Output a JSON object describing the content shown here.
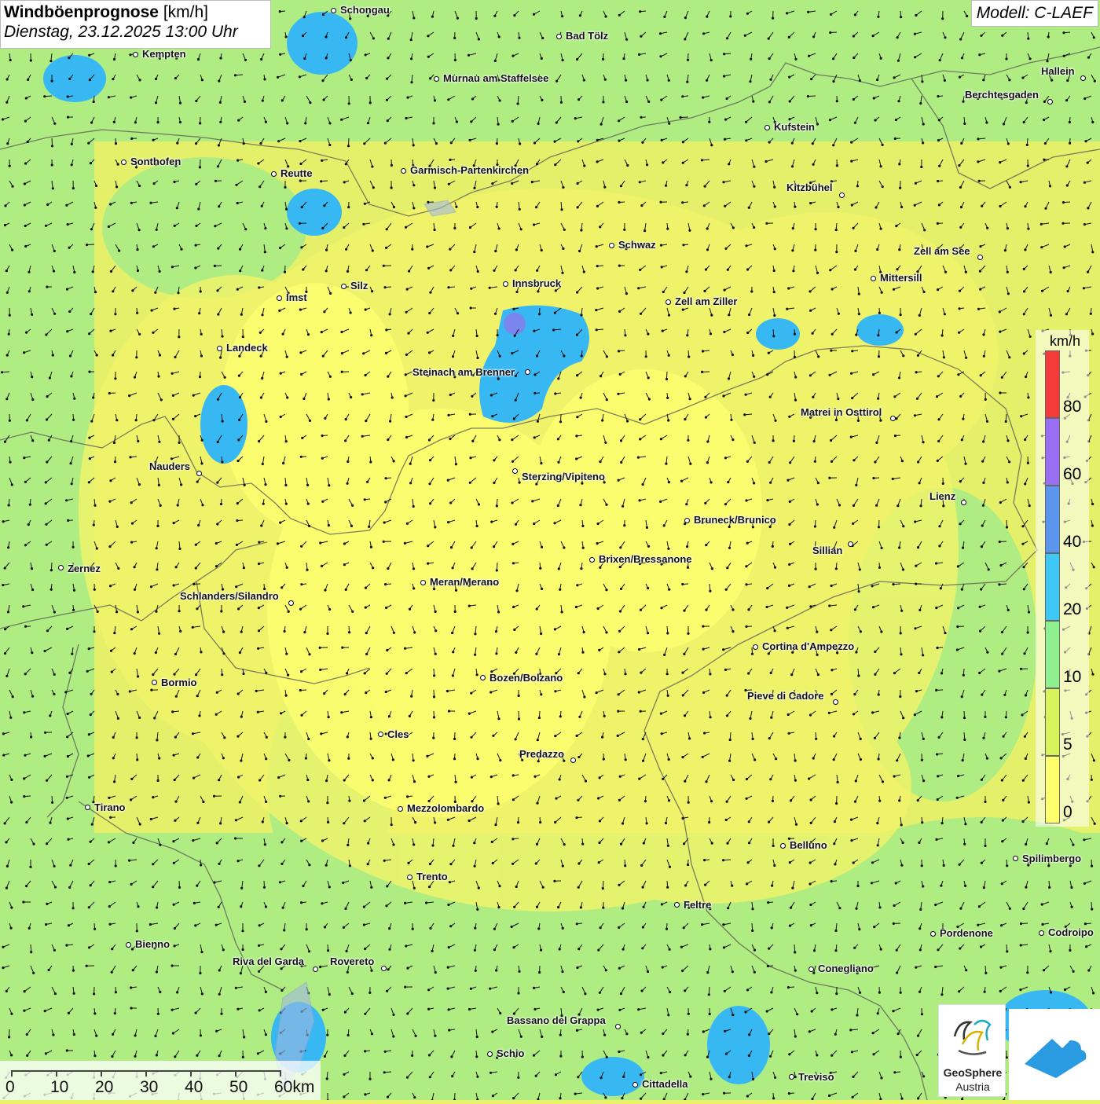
{
  "header": {
    "title": "Windböenprognose",
    "unit": "[km/h]",
    "datetime": "Dienstag, 23.12.2025 13:00 Uhr",
    "model": "Modell: C-LAEF"
  },
  "legend": {
    "unit": "km/h",
    "colors": [
      "#ffff6e",
      "#d7f55a",
      "#8ef08e",
      "#3ec8f5",
      "#5a96ee",
      "#9a6ef2",
      "#f53a3a"
    ],
    "values": [
      "0",
      "5",
      "10",
      "20",
      "40",
      "60",
      "80"
    ]
  },
  "cities": [
    {
      "name": "Schongau",
      "label": "Schongau"
    },
    {
      "name": "Bad Tölz",
      "label": "Bad Tölz"
    },
    {
      "name": "Kempten",
      "label": "Kempten"
    },
    {
      "name": "Murnau am Staffelsee",
      "label": "Murnau am Staffelsee"
    },
    {
      "name": "Hallein",
      "label": "Hallein"
    },
    {
      "name": "Berchtesgaden",
      "label": "Berchtesgaden"
    },
    {
      "name": "Kufstein",
      "label": "Kufstein"
    },
    {
      "name": "Sonthofen",
      "label": "Sonthofen"
    },
    {
      "name": "Reutte",
      "label": "Reutte"
    },
    {
      "name": "Garmisch-Partenkirchen",
      "label": "Garmisch-Partenkirchen"
    },
    {
      "name": "Kitzbühel",
      "label": "Kitzbühel"
    },
    {
      "name": "Schwaz",
      "label": "Schwaz"
    },
    {
      "name": "Zell am See",
      "label": "Zell am See"
    },
    {
      "name": "Innsbruck",
      "label": "Innsbruck"
    },
    {
      "name": "Mittersill",
      "label": "Mittersill"
    },
    {
      "name": "Silz",
      "label": "Silz"
    },
    {
      "name": "Imst",
      "label": "Imst"
    },
    {
      "name": "Zell am Ziller",
      "label": "Zell am Ziller"
    },
    {
      "name": "Landeck",
      "label": "Landeck"
    },
    {
      "name": "Steinach am Brenner",
      "label": "Steinach am Brenner"
    },
    {
      "name": "Matrei in Osttirol",
      "label": "Matrei in Osttirol"
    },
    {
      "name": "Nauders",
      "label": "Nauders"
    },
    {
      "name": "Sterzing/Vipiteno",
      "label": "Sterzing/Vipiteno"
    },
    {
      "name": "Lienz",
      "label": "Lienz"
    },
    {
      "name": "Bruneck/Brunico",
      "label": "Bruneck/Brunico"
    },
    {
      "name": "Sillian",
      "label": "Sillian"
    },
    {
      "name": "Brixen/Bressanone",
      "label": "Brixen/Bressanone"
    },
    {
      "name": "Zernez",
      "label": "Zernez"
    },
    {
      "name": "Meran/Merano",
      "label": "Meran/Merano"
    },
    {
      "name": "Schlanders/Silandro",
      "label": "Schlanders/Silandro"
    },
    {
      "name": "Cortina d'Ampezzo",
      "label": "Cortina d'Ampezzo"
    },
    {
      "name": "Bozen/Bolzano",
      "label": "Bozen/Bolzano"
    },
    {
      "name": "Bormio",
      "label": "Bormio"
    },
    {
      "name": "Pieve di Cadore",
      "label": "Pieve di Cadore"
    },
    {
      "name": "Cles",
      "label": "Cles"
    },
    {
      "name": "Predazzo",
      "label": "Predazzo"
    },
    {
      "name": "Tirano",
      "label": "Tirano"
    },
    {
      "name": "Mezzolombardo",
      "label": "Mezzolombardo"
    },
    {
      "name": "Belluno",
      "label": "Belluno"
    },
    {
      "name": "Spilimbergo",
      "label": "Spilimbergo"
    },
    {
      "name": "Trento",
      "label": "Trento"
    },
    {
      "name": "Feltre",
      "label": "Feltre"
    },
    {
      "name": "Pordenone",
      "label": "Pordenone"
    },
    {
      "name": "Codroipo",
      "label": "Codroipo"
    },
    {
      "name": "Bienno",
      "label": "Bienno"
    },
    {
      "name": "Riva del Garda",
      "label": "Riva del Garda"
    },
    {
      "name": "Rovereto",
      "label": "Rovereto"
    },
    {
      "name": "Conegliano",
      "label": "Conegliano"
    },
    {
      "name": "Bassano del Grappa",
      "label": "Bassano del Grappa"
    },
    {
      "name": "Schio",
      "label": "Schio"
    },
    {
      "name": "Treviso",
      "label": "Treviso"
    },
    {
      "name": "Cittadella",
      "label": "Cittadella"
    }
  ],
  "scale": {
    "labels": [
      "0",
      "10",
      "20",
      "30",
      "40",
      "50",
      "60km"
    ]
  },
  "logos": {
    "org_line1": "GeoSphere",
    "org_line2": "Austria"
  }
}
